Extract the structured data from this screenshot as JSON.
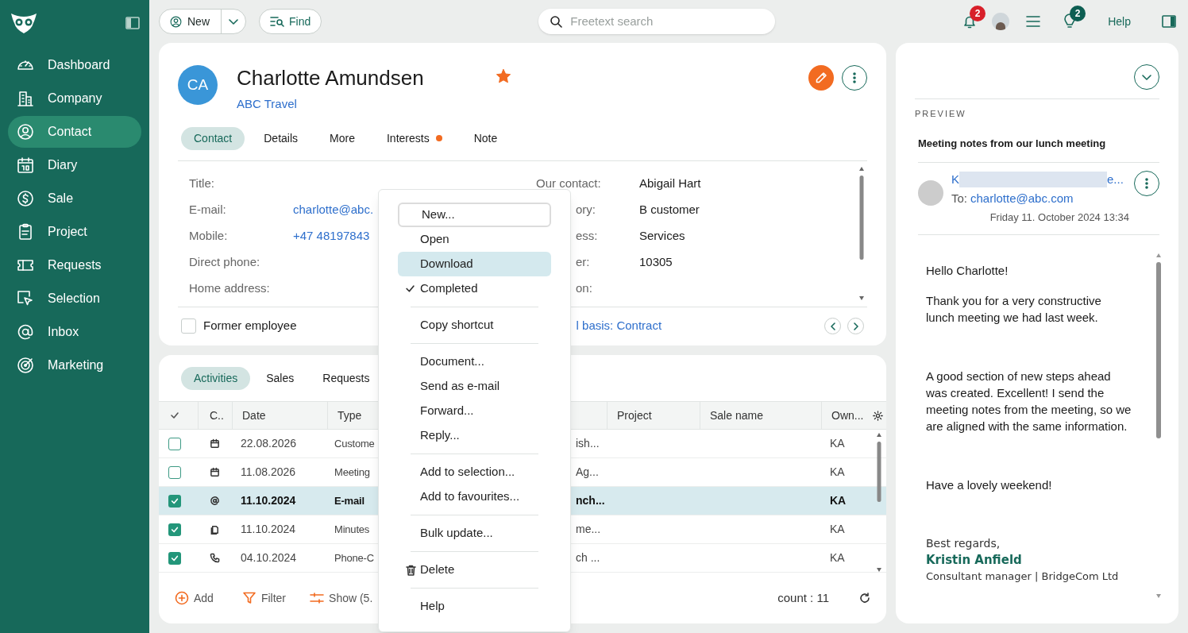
{
  "sidebar": {
    "items": [
      {
        "label": "Dashboard",
        "selected": false
      },
      {
        "label": "Company",
        "selected": false
      },
      {
        "label": "Contact",
        "selected": true
      },
      {
        "label": "Diary",
        "selected": false
      },
      {
        "label": "Sale",
        "selected": false
      },
      {
        "label": "Project",
        "selected": false
      },
      {
        "label": "Requests",
        "selected": false
      },
      {
        "label": "Selection",
        "selected": false
      },
      {
        "label": "Inbox",
        "selected": false
      },
      {
        "label": "Marketing",
        "selected": false
      }
    ]
  },
  "toolbar": {
    "new_label": "New",
    "find_label": "Find",
    "search": {
      "placeholder": "Freetext search"
    },
    "notifications_badge": "2",
    "ideas_badge": "2",
    "help_label": "Help"
  },
  "contact": {
    "initials": "CA",
    "name": "Charlotte Amundsen",
    "company": "ABC Travel",
    "favourite": true,
    "tabs": [
      {
        "label": "Contact",
        "selected": true,
        "dot": false
      },
      {
        "label": "Details",
        "selected": false,
        "dot": false
      },
      {
        "label": "More",
        "selected": false,
        "dot": false
      },
      {
        "label": "Interests",
        "selected": false,
        "dot": true
      },
      {
        "label": "Note",
        "selected": false,
        "dot": false
      }
    ],
    "fields_left": [
      {
        "label": "Title:"
      },
      {
        "label": "E-mail:",
        "value": "charlotte@abc."
      },
      {
        "label": "Mobile:",
        "value": "+47 48197843"
      },
      {
        "label": "Direct phone:"
      },
      {
        "label": "Home address:"
      }
    ],
    "fields_right": [
      {
        "label": "Our contact:",
        "value": "Abigail Hart"
      },
      {
        "label": "ory:",
        "value": "B customer"
      },
      {
        "label": "ess:",
        "value": "Services"
      },
      {
        "label": "er:",
        "value": "10305"
      },
      {
        "label": "on:"
      }
    ],
    "former_employee": {
      "label": "Former employee",
      "checked": false
    },
    "footer_link": "l basis: Contract"
  },
  "activities": {
    "tabs": [
      {
        "label": "Activities",
        "selected": true
      },
      {
        "label": "Sales",
        "selected": false
      },
      {
        "label": "Requests",
        "selected": false
      }
    ],
    "columns": [
      "C..",
      "Date",
      "Type",
      "Project",
      "Sale name",
      "Own..."
    ],
    "rows": [
      {
        "kind": "appointment",
        "checked": false,
        "selected": false,
        "date": "22.08.2026",
        "type": "Custome",
        "column_5": "ish...",
        "owner": "KA"
      },
      {
        "kind": "appointment",
        "checked": false,
        "selected": false,
        "date": "11.08.2026",
        "type": "Meeting",
        "column_5": "Ag...",
        "owner": "KA"
      },
      {
        "kind": "email",
        "checked": true,
        "selected": true,
        "date": "11.10.2024",
        "type": "E-mail",
        "column_5": "nch...",
        "owner": "KA"
      },
      {
        "kind": "document",
        "checked": true,
        "selected": false,
        "date": "11.10.2024",
        "type": "Minutes",
        "column_5": "me...",
        "owner": "KA"
      },
      {
        "kind": "phone",
        "checked": true,
        "selected": false,
        "date": "04.10.2024",
        "type": "Phone-C",
        "column_5": "ch ...",
        "owner": "KA"
      }
    ],
    "add_label": "Add",
    "filter_label": "Filter",
    "show_label": "Show (5.",
    "count": "count : 11"
  },
  "context_menu": {
    "groups": [
      [
        {
          "label": "New...",
          "kind": "plain",
          "focused": true,
          "highlighted": false,
          "checked": false
        },
        {
          "label": "Open",
          "kind": "plain",
          "focused": false,
          "highlighted": false,
          "checked": false
        },
        {
          "label": "Download",
          "kind": "plain",
          "focused": false,
          "highlighted": true,
          "checked": false
        },
        {
          "label": "Completed",
          "kind": "plain",
          "focused": false,
          "highlighted": false,
          "checked": true
        }
      ],
      [
        {
          "label": "Copy shortcut",
          "kind": "plain",
          "focused": false,
          "highlighted": false,
          "checked": false
        }
      ],
      [
        {
          "label": "Document...",
          "kind": "plain",
          "focused": false,
          "highlighted": false,
          "checked": false
        },
        {
          "label": "Send as e-mail",
          "kind": "plain",
          "focused": false,
          "highlighted": false,
          "checked": false
        },
        {
          "label": "Forward...",
          "kind": "plain",
          "focused": false,
          "highlighted": false,
          "checked": false
        },
        {
          "label": "Reply...",
          "kind": "plain",
          "focused": false,
          "highlighted": false,
          "checked": false
        }
      ],
      [
        {
          "label": "Add to selection...",
          "kind": "plain",
          "focused": false,
          "highlighted": false,
          "checked": false
        },
        {
          "label": "Add to favourites...",
          "kind": "plain",
          "focused": false,
          "highlighted": false,
          "checked": false
        }
      ],
      [
        {
          "label": "Bulk update...",
          "kind": "plain",
          "focused": false,
          "highlighted": false,
          "checked": false
        }
      ],
      [
        {
          "label": "Delete",
          "kind": "trash",
          "focused": false,
          "highlighted": false,
          "checked": false
        }
      ],
      [
        {
          "label": "Help",
          "kind": "plain",
          "focused": false,
          "highlighted": false,
          "checked": false
        }
      ]
    ]
  },
  "preview": {
    "heading": "PREVIEW",
    "subject": "Meeting notes from our lunch meeting",
    "sender_start": "K",
    "sender_end": "e...",
    "to_label": "To:",
    "to": "charlotte@abc.com",
    "date": "Friday 11. October 2024 13:34",
    "body": [
      "Hello Charlotte!",
      "Thank you for a very constructive lunch meeting we had last week.",
      "A good section of new steps ahead was created. Excellent! I send the meeting notes from the meeting, so we are aligned with the same information.",
      "Have a lovely weekend!"
    ],
    "closing": "Best regards,",
    "signature_name": "Kristin Anfield",
    "signature_title": "Consultant manager | BridgeCom Ltd"
  }
}
